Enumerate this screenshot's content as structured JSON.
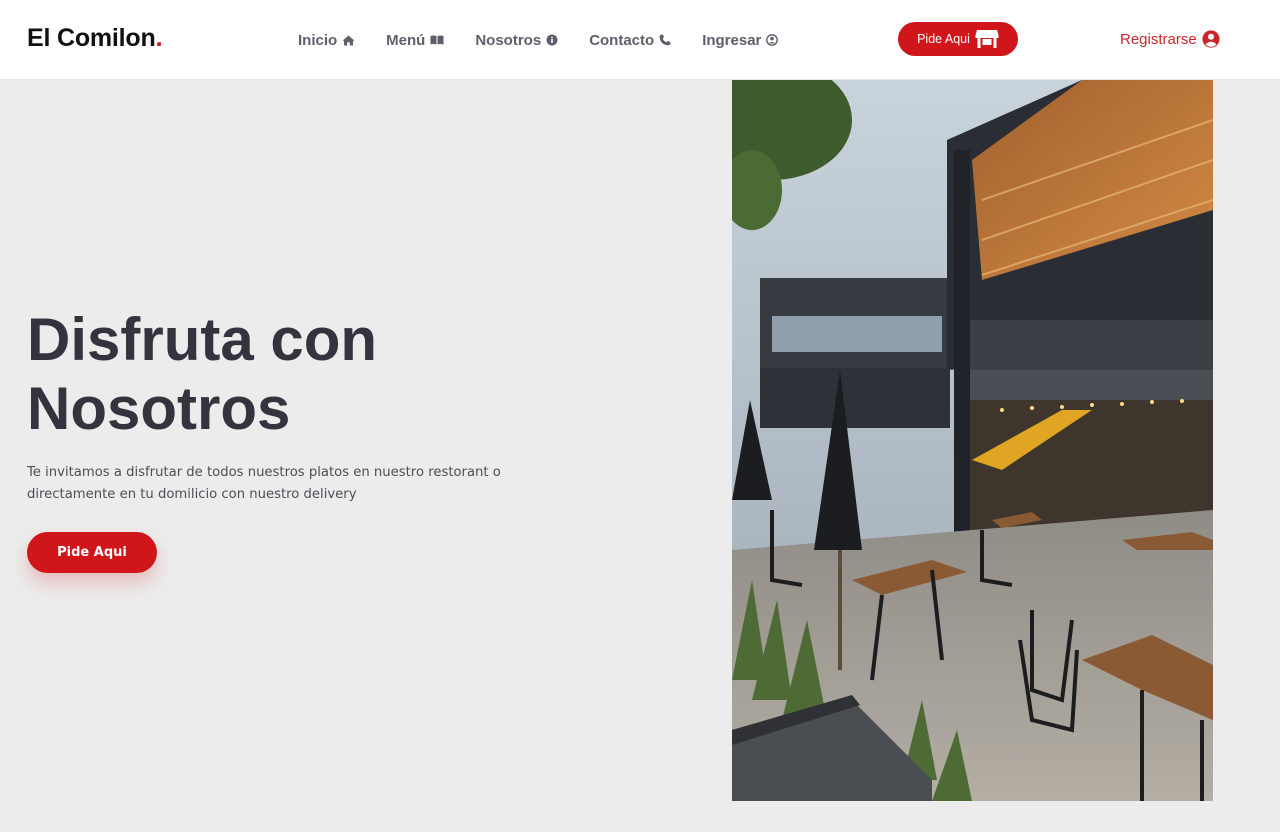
{
  "brand": {
    "name": "El Comilon",
    "dot": "."
  },
  "nav": {
    "items": [
      {
        "label": "Inicio",
        "icon": "home-icon"
      },
      {
        "label": "Menú",
        "icon": "book-icon"
      },
      {
        "label": "Nosotros",
        "icon": "info-icon"
      },
      {
        "label": "Contacto",
        "icon": "phone-icon"
      },
      {
        "label": "Ingresar",
        "icon": "user-circle-icon"
      }
    ],
    "order_button": {
      "label": "Pide Aqui",
      "icon": "store-icon"
    },
    "register": {
      "label": "Registrarse",
      "icon": "user-icon"
    }
  },
  "hero": {
    "title_line1": "Disfruta con",
    "title_line2": "Nosotros",
    "text": "Te invitamos a disfrutar de todos nuestros platos en nuestro restorant o directamente en tu domilicio con nuestro delivery",
    "button": "Pide Aqui",
    "image_icon": "restaurant-photo"
  },
  "colors": {
    "accent": "#d0161b",
    "nav_text": "#5f5f6b",
    "title": "#34343e",
    "background": "#ececec"
  }
}
